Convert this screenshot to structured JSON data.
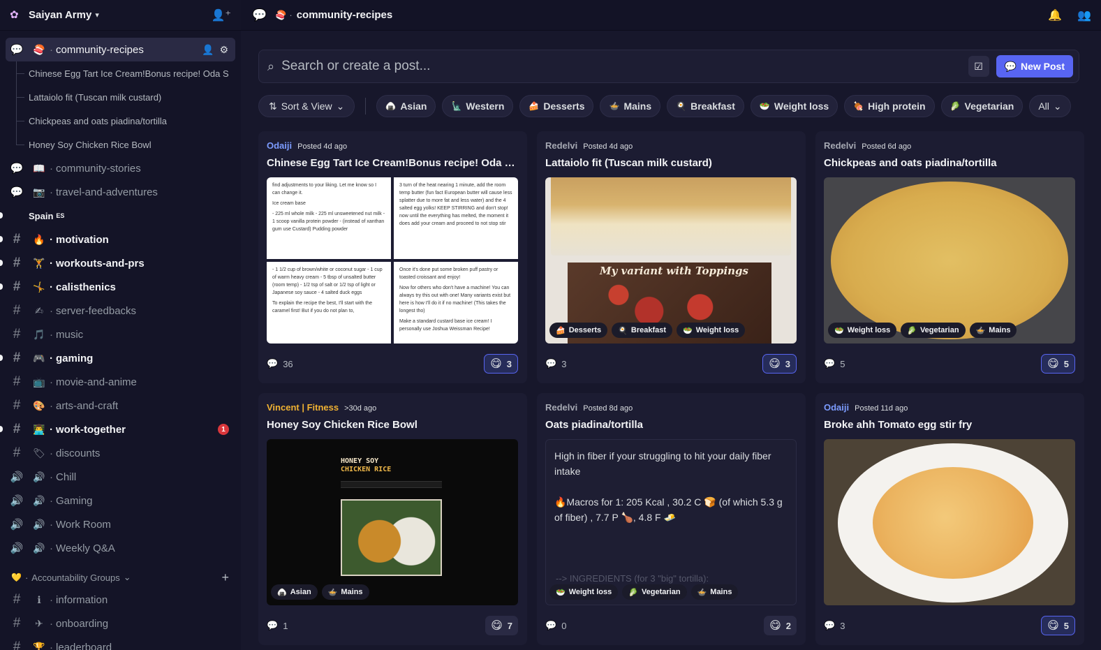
{
  "server": {
    "name": "Saiyan Army"
  },
  "channels": [
    {
      "kind": "forum",
      "emoji": "🍣",
      "name": "community-recipes",
      "active": true
    },
    {
      "kind": "thread",
      "name": "Chinese Egg Tart Ice Cream!Bonus recipe! Oda S"
    },
    {
      "kind": "thread",
      "name": "Lattaiolo fit (Tuscan milk custard)"
    },
    {
      "kind": "thread",
      "name": "Chickpeas and oats piadina/tortilla"
    },
    {
      "kind": "thread",
      "name": "Honey Soy Chicken Rice Bowl"
    },
    {
      "kind": "forum",
      "emoji": "📖",
      "name": "community-stories"
    },
    {
      "kind": "forum",
      "emoji": "📷",
      "name": "travel-and-adventures"
    },
    {
      "kind": "subcat",
      "name": "Spain",
      "flag": "ES"
    },
    {
      "kind": "text",
      "emoji": "🔥",
      "name": "motivation",
      "bold": true
    },
    {
      "kind": "text",
      "emoji": "🏋",
      "name": "workouts-and-prs",
      "bold": true
    },
    {
      "kind": "text",
      "emoji": "🤸",
      "name": "calisthenics",
      "bold": true
    },
    {
      "kind": "text",
      "emoji": "✍",
      "name": "server-feedbacks"
    },
    {
      "kind": "text",
      "emoji": "🎵",
      "name": "music"
    },
    {
      "kind": "text",
      "emoji": "🎮",
      "name": "gaming",
      "bold": true
    },
    {
      "kind": "text",
      "emoji": "📺",
      "name": "movie-and-anime"
    },
    {
      "kind": "text",
      "emoji": "🎨",
      "name": "arts-and-craft"
    },
    {
      "kind": "text",
      "emoji": "👨‍💻",
      "name": "work-together",
      "bold": true,
      "badge": "1"
    },
    {
      "kind": "text",
      "emoji": "🏷",
      "name": "discounts"
    },
    {
      "kind": "voice",
      "emoji": "🔊",
      "name": "Chill"
    },
    {
      "kind": "voice",
      "emoji": "🔊",
      "name": "Gaming"
    },
    {
      "kind": "voice",
      "emoji": "🔊",
      "name": "Work Room"
    },
    {
      "kind": "stage",
      "emoji": "🔊",
      "name": "Weekly Q&A"
    },
    {
      "kind": "category",
      "emoji": "💛",
      "name": "Accountability Groups"
    },
    {
      "kind": "text",
      "emoji": "ℹ",
      "name": "information"
    },
    {
      "kind": "text",
      "emoji": "✈",
      "name": "onboarding"
    },
    {
      "kind": "text",
      "emoji": "🏆",
      "name": "leaderboard"
    }
  ],
  "topbar": {
    "channel_emoji": "🍣",
    "channel_name": "community-recipes"
  },
  "search": {
    "placeholder": "Search or create a post...",
    "new_post_label": "New Post"
  },
  "sort_label": "Sort & View",
  "tags": [
    {
      "emoji": "🍙",
      "label": "Asian"
    },
    {
      "emoji": "🗽",
      "label": "Western"
    },
    {
      "emoji": "🍰",
      "label": "Desserts"
    },
    {
      "emoji": "🍲",
      "label": "Mains"
    },
    {
      "emoji": "🍳",
      "label": "Breakfast"
    },
    {
      "emoji": "🥗",
      "label": "Weight loss"
    },
    {
      "emoji": "🍖",
      "label": "High protein"
    },
    {
      "emoji": "🥬",
      "label": "Vegetarian"
    }
  ],
  "all_label": "All",
  "posts": [
    {
      "author": "Odaiji",
      "author_color": "#7c9cff",
      "posted": "Posted 4d ago",
      "title": "Chinese Egg Tart Ice Cream!Bonus recipe! Oda S...",
      "comments": "36",
      "reactions": "3",
      "react_emoji": "😋",
      "mine": true,
      "media": "doc",
      "tags": [],
      "doc_text": [
        "find adjustments to your liking. Let me know so I can change it.",
        "Ice cream base",
        "- 225 ml whole milk - 225 ml unsweetened nut milk - 1 scoop vanilla protein powder - (instead of xanthan gum use Custard) Pudding powder",
        "3 turn of the heat nearing 1 minute, add the room temp butter (fun fact European butter will cause less splatter due to more fat and less water) and the 4 salted egg yolks! KEEP STIRRING and don't stop! now until the everything has melted, the moment it does add your cream and proceed to not stop stir",
        "- 1 1/2 cup of brown/white or coconut sugar - 1 cup of warm heavy cream - 5 tbsp of unsalted butter (room temp) - 1/2 tsp of salt or 1/2 tsp of light or Japanese soy sauce - 4 salted duck eggs",
        "To explain the recipe the best, I'll start with the caramel first! But if you do not plan to,",
        "Once it's done put some broken puff pastry or toasted croissant and enjoy!",
        "Now for others who don't have a machine! You can always try this out with one! Many variants exist but here is how I'll do it if no machine! (This takes the longest tho)",
        "Make a standard custard base ice cream! I personally use Joshua Weissman Recipe!"
      ]
    },
    {
      "author": "Redelvi",
      "author_color": "#a6a9b3",
      "posted": "Posted 4d ago",
      "title": "Lattaiolo fit (Tuscan milk custard)",
      "comments": "3",
      "reactions": "3",
      "react_emoji": "😋",
      "mine": true,
      "media": "custard",
      "banner": "My variant with Toppings",
      "tags": [
        {
          "emoji": "🍰",
          "label": "Desserts"
        },
        {
          "emoji": "🍳",
          "label": "Breakfast"
        },
        {
          "emoji": "🥗",
          "label": "Weight loss"
        }
      ]
    },
    {
      "author": "Redelvi",
      "author_color": "#a6a9b3",
      "posted": "Posted 6d ago",
      "title": "Chickpeas and oats piadina/tortilla",
      "comments": "5",
      "reactions": "5",
      "react_emoji": "😋",
      "mine": true,
      "media": "piadina",
      "tags": [
        {
          "emoji": "🥗",
          "label": "Weight loss"
        },
        {
          "emoji": "🥬",
          "label": "Vegetarian"
        },
        {
          "emoji": "🍲",
          "label": "Mains"
        }
      ]
    },
    {
      "author": "Vincent | Fitness",
      "author_color": "#f0b232",
      "posted": ">30d ago",
      "title": "Honey Soy Chicken Rice Bowl",
      "comments": "1",
      "reactions": "7",
      "react_emoji": "😋",
      "mine": false,
      "media": "honey",
      "honey_line1": "HONEY SOY",
      "honey_line2": "CHICKEN RICE",
      "tags": [
        {
          "emoji": "🍙",
          "label": "Asian"
        },
        {
          "emoji": "🍲",
          "label": "Mains"
        }
      ]
    },
    {
      "author": "Redelvi",
      "author_color": "#a6a9b3",
      "posted": "Posted 8d ago",
      "title": "Oats piadina/tortilla",
      "comments": "0",
      "reactions": "2",
      "react_emoji": "😋",
      "mine": false,
      "media": "text",
      "text_p1": "High in fiber if your struggling to hit your daily fiber intake",
      "text_p2": "🔥Macros for 1:  205 Kcal , 30.2 C 🍞 (of which 5.3 g of fiber) , 7.7 P 🍗,  4.8 F 🧈",
      "text_fade": "--> INGREDIENTS (for 3 \"big\" tortilla):",
      "tags": [
        {
          "emoji": "🥗",
          "label": "Weight loss"
        },
        {
          "emoji": "🥬",
          "label": "Vegetarian"
        },
        {
          "emoji": "🍲",
          "label": "Mains"
        }
      ]
    },
    {
      "author": "Odaiji",
      "author_color": "#7c9cff",
      "posted": "Posted 11d ago",
      "title": "Broke ahh Tomato egg stir fry",
      "comments": "3",
      "reactions": "5",
      "react_emoji": "😋",
      "mine": true,
      "media": "tomato",
      "tags": []
    }
  ],
  "colors": {
    "accent": "#5865f2",
    "badge": "#da373c"
  }
}
